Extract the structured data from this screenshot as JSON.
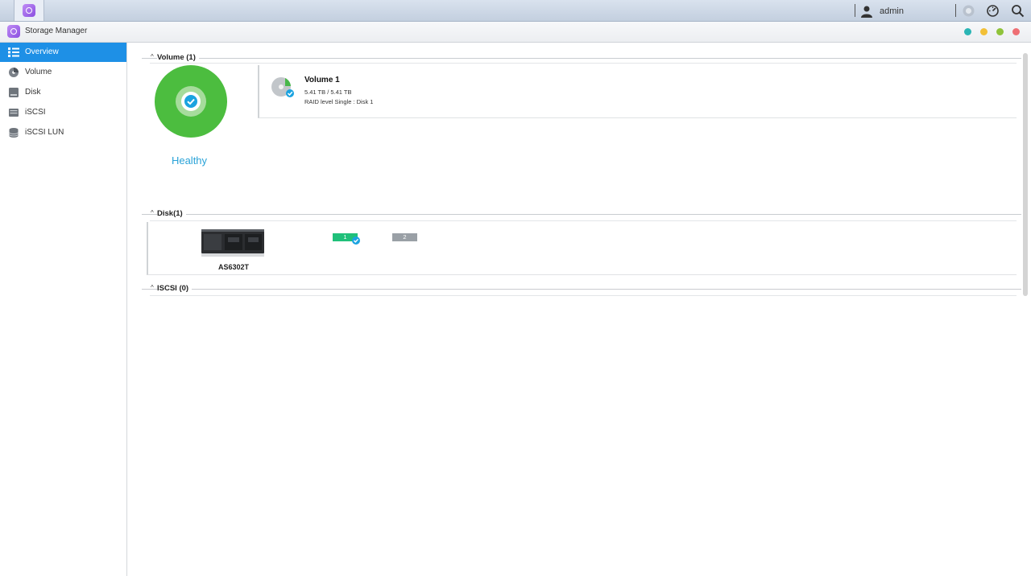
{
  "taskbar": {
    "app_icon": "storage-manager-icon",
    "user": "admin",
    "icons": [
      "user-icon",
      "notification-icon",
      "settings-dial-icon",
      "search-icon"
    ]
  },
  "window": {
    "title": "Storage Manager",
    "controls": [
      {
        "name": "window-control-teal",
        "color": "#2ab5b5"
      },
      {
        "name": "window-control-yellow",
        "color": "#f2c037"
      },
      {
        "name": "window-control-green",
        "color": "#8fc33a"
      },
      {
        "name": "window-control-red",
        "color": "#ee6f74"
      }
    ]
  },
  "sidebar": {
    "items": [
      {
        "label": "Overview",
        "icon": "list-icon",
        "active": true
      },
      {
        "label": "Volume",
        "icon": "volume-icon",
        "active": false
      },
      {
        "label": "Disk",
        "icon": "disk-icon",
        "active": false
      },
      {
        "label": "iSCSI",
        "icon": "iscsi-icon",
        "active": false
      },
      {
        "label": "iSCSI LUN",
        "icon": "iscsi-lun-icon",
        "active": false
      }
    ]
  },
  "volume_section": {
    "header": "Volume (1)",
    "health": "Healthy",
    "card": {
      "name": "Volume 1",
      "size": "5.41 TB / 5.41 TB",
      "raid": "RAID level Single : Disk 1"
    }
  },
  "disk_section": {
    "header": "Disk(1)",
    "device": "AS6302T",
    "slots": [
      {
        "label": "1",
        "status": "ok"
      },
      {
        "label": "2",
        "status": "empty"
      }
    ]
  },
  "iscsi_section": {
    "header": "ISCSI (0)"
  },
  "colors": {
    "accent": "#1e90e6",
    "healthy": "#4cbd3f",
    "healthy_text": "#2aa3d8",
    "disk_ok": "#20c07a"
  }
}
